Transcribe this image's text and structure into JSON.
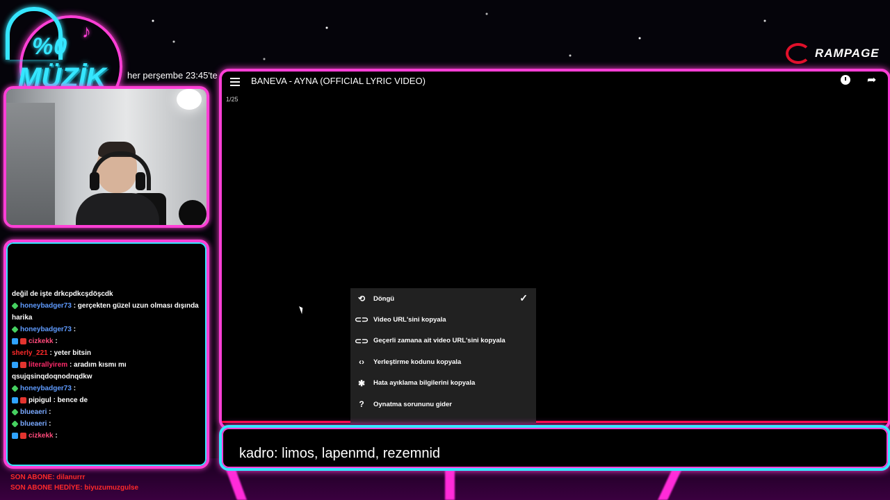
{
  "logo": {
    "percent": "%0",
    "word": "MÜZİK"
  },
  "schedule": "her perşembe 23:45'te",
  "sponsor": "RAMPAGE",
  "video": {
    "title": "BANEVA - AYNA (OFFICIAL LYRIC VIDEO)",
    "counter": "1/25"
  },
  "context_menu": [
    {
      "label": "Döngü",
      "icon": "loop-icon",
      "checked": true
    },
    {
      "label": "Video URL'sini kopyala",
      "icon": "link-icon"
    },
    {
      "label": "Geçerli zamana ait video URL'sini kopyala",
      "icon": "link-icon"
    },
    {
      "label": "Yerleştirme kodunu kopyala",
      "icon": "code-icon"
    },
    {
      "label": "Hata ayıklama bilgilerini kopyala",
      "icon": "bug-icon"
    },
    {
      "label": "Oynatma sorununu gider",
      "icon": "help-icon"
    }
  ],
  "chat": [
    {
      "user": "",
      "text": "değil de işte drkcpdkcşdöşcdk",
      "user_color": "#ffffff",
      "badges": []
    },
    {
      "user": "honeybadger73",
      "text": ": gerçekten güzel uzun olması dışında harika",
      "user_color": "#5f9bff",
      "badges": [
        "green"
      ]
    },
    {
      "user": "honeybadger73",
      "text": ": ",
      "user_color": "#5f9bff",
      "badges": [
        "green"
      ]
    },
    {
      "user": "cizkekk",
      "text": ": ",
      "user_color": "#ff4a7a",
      "badges": [
        "blue",
        "red"
      ]
    },
    {
      "user": "sherly_221",
      "text": ": yeter bitsin",
      "user_color": "#ff2a2a",
      "badges": []
    },
    {
      "user": "literallyirem",
      "text": ": aradım kısmı mı qsujqsinqdoqnodnqdkw",
      "user_color": "#ff2a6a",
      "badges": [
        "blue",
        "red"
      ]
    },
    {
      "user": "honeybadger73",
      "text": ": ",
      "user_color": "#5f9bff",
      "badges": [
        "green"
      ]
    },
    {
      "user": "pipigul",
      "text": ": bence de",
      "user_color": "#ffffff",
      "badges": [
        "blue",
        "red"
      ]
    },
    {
      "user": "blueaeri",
      "text": ": ",
      "user_color": "#7aa9ff",
      "badges": [
        "green"
      ]
    },
    {
      "user": "blueaeri",
      "text": ": ",
      "user_color": "#7aa9ff",
      "badges": [
        "green"
      ]
    },
    {
      "user": "cizkekk",
      "text": ": ",
      "user_color": "#ff4a7a",
      "badges": [
        "blue",
        "red"
      ]
    }
  ],
  "sub_last": "SON ABONE: dilanurrr",
  "sub_gift": "SON ABONE HEDİYE: biyuzumuzgulse",
  "caption": "kadro: limos, lapenmd, rezemnid",
  "colors": {
    "neon_pink": "#ff3fd6",
    "neon_cyan": "#35e6ff",
    "accent_red": "#ff0033"
  }
}
